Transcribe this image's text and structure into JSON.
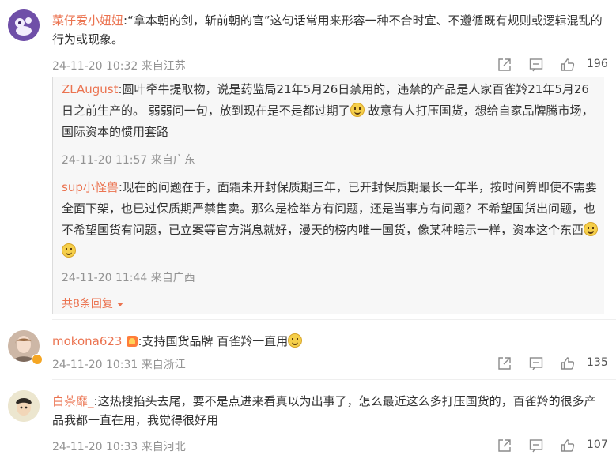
{
  "comments": [
    {
      "username": "菜仔爱小妞妞",
      "text": ":“拿本朝的剑，斩前朝的官”这句话常用来形容一种不合时宜、不遵循既有规则或逻辑混乱的行为或现象。",
      "time": "24-11-20 10:32",
      "location": "来自江苏",
      "likes": "196"
    },
    {
      "username": "mokona623",
      "text": ":支持国货品牌   百雀羚一直用",
      "time": "24-11-20 10:31",
      "location": "来自浙江",
      "likes": "135"
    },
    {
      "username": "白茶靡_",
      "text": ":这热搜掐头去尾，要不是点进来看真以为出事了，怎么最近这么多打压国货的，百雀羚的很多产品我都一直在用，我觉得很好用",
      "time": "24-11-20 10:33",
      "location": "来自河北",
      "likes": "107"
    }
  ],
  "replies": [
    {
      "username": "ZLAugust",
      "text_before_emoji": ":圆叶牵牛提取物，说是药监局21年5月26日禁用的，违禁的产品是人家百雀羚21年5月26日之前生产的。 弱弱问一句，放到现在是不是都过期了",
      "text_after_emoji": " 故意有人打压国货，想给自家品牌腾市场，国际资本的惯用套路",
      "time": "24-11-20 11:57",
      "location": "来自广东"
    },
    {
      "username": "sup小怪兽",
      "text": ":现在的问题在于，面霜未开封保质期三年，已开封保质期最长一年半，按时间算即使不需要全面下架，也已过保质期严禁售卖。那么是检举方有问题，还是当事方有问题？不希望国货出问题，也不希望国货有问题，已立案等官方消息就好，漫天的榜内唯一国货，像某种暗示一样，资本这个东西",
      "time": "24-11-20 11:44",
      "location": "来自广西"
    }
  ],
  "more_replies": "共8条回复",
  "colors": {
    "username": "#eb7350",
    "meta": "#939393",
    "reply_bg": "#f7f7f7"
  },
  "icons": [
    "share-icon",
    "comment-icon",
    "like-icon",
    "caret-down-icon",
    "vip-badge-icon",
    "emoji-icon"
  ]
}
